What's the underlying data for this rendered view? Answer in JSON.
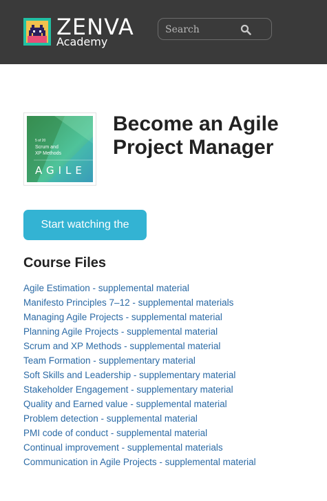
{
  "header": {
    "brand": "ZENVA",
    "subbrand": "Academy",
    "search_placeholder": "Search"
  },
  "course": {
    "thumbnail": {
      "counter": "5 of 20",
      "lines": [
        "Scrum and",
        "XP Methods"
      ],
      "big_text": "AGILE"
    },
    "title": "Become an Agile Project Manager",
    "start_button": "Start watching the course"
  },
  "files": {
    "heading": "Course Files",
    "items": [
      "Agile Estimation - supplemental material",
      "Manifesto Principles 7–12 - supplemental materials",
      "Managing Agile Projects - supplemental material",
      "Planning Agile Projects - supplemental material",
      "Scrum and XP Methods - supplemental material",
      "Team Formation - supplementary material",
      "Soft Skills and Leadership - supplementary material",
      "Stakeholder Engagement - supplementary material",
      "Quality and Earned value - supplemental material",
      "Problem detection - supplemental material",
      "PMI code of conduct - supplemental material",
      "Continual improvement - supplemental materials",
      "Communication in Agile Projects - supplemental material"
    ]
  },
  "colors": {
    "header_bg": "#3a3a3a",
    "accent": "#33b3d3",
    "link": "#2b6aa5"
  }
}
